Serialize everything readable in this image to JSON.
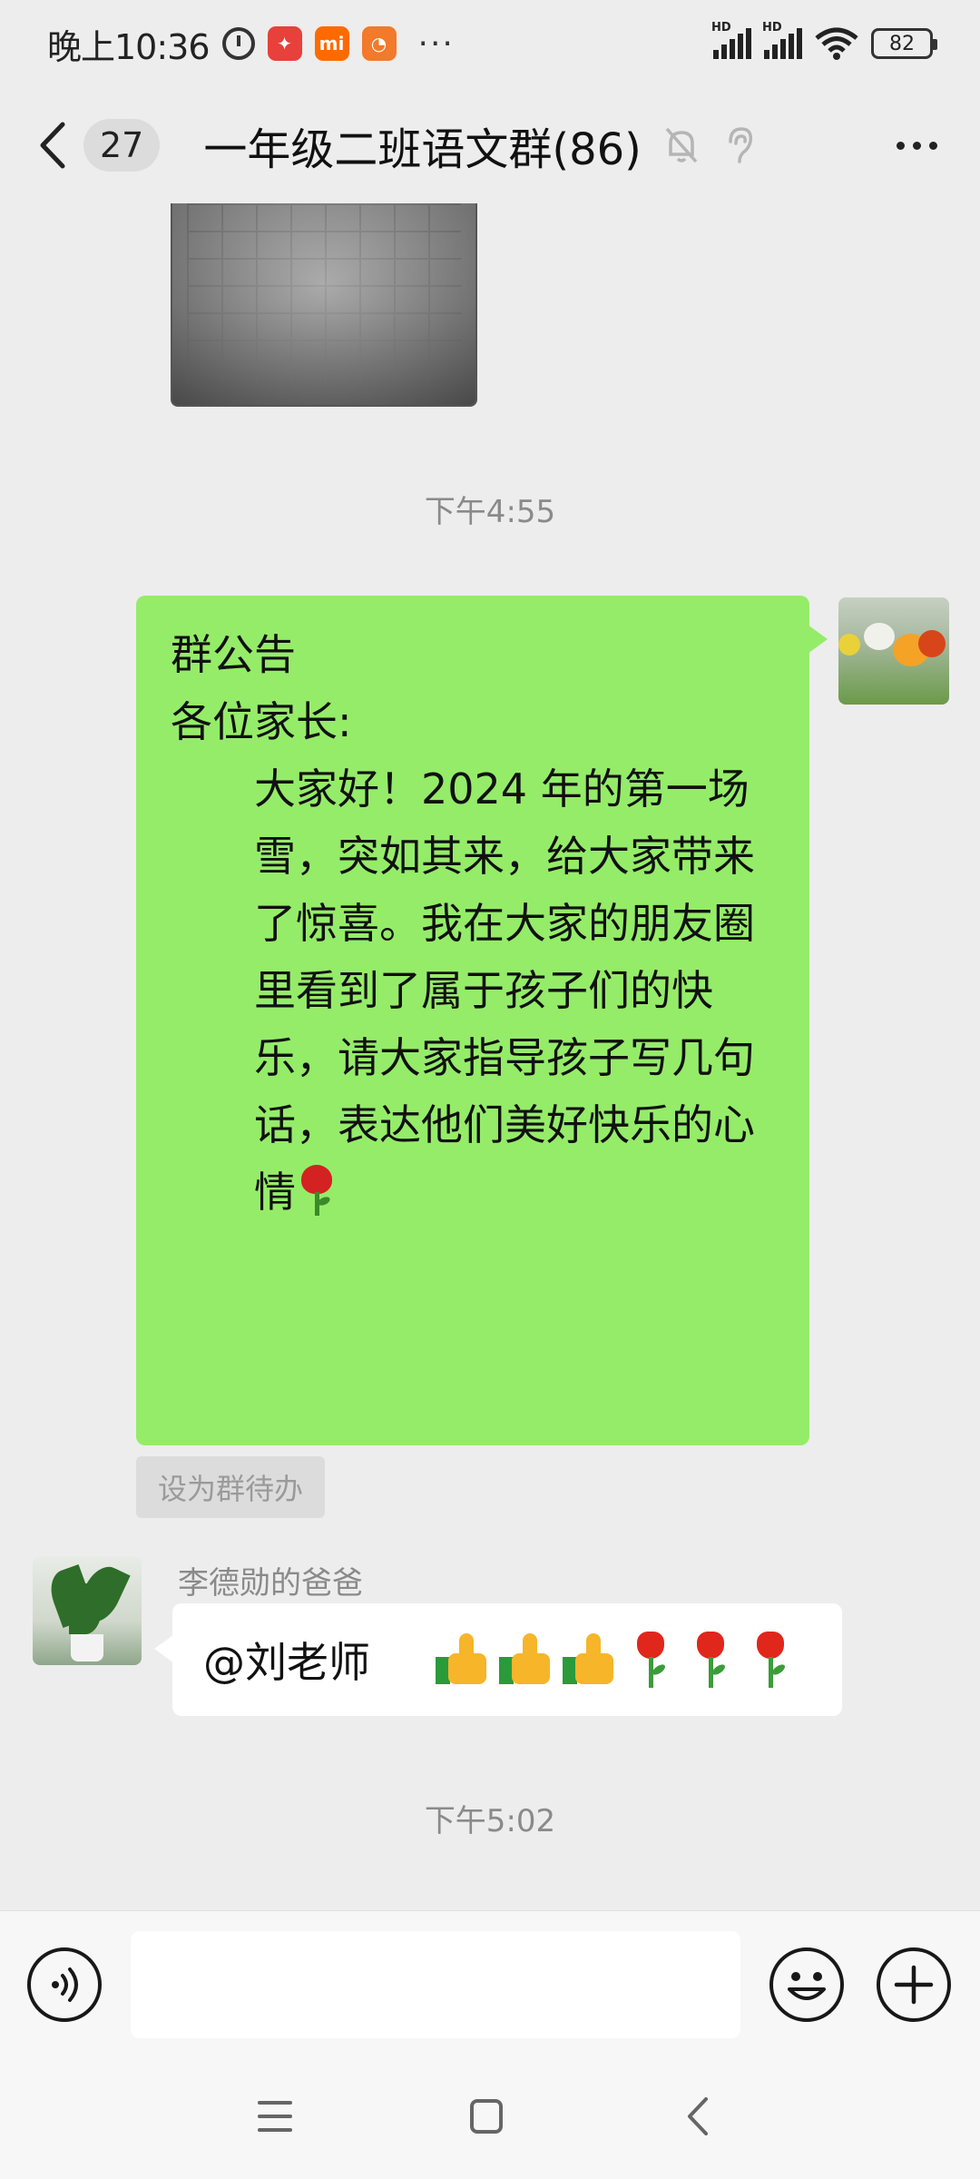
{
  "status_bar": {
    "time": "晚上10:36",
    "battery": "82",
    "signal_label_1": "HD",
    "signal_label_2": "HD",
    "app_icons": [
      "alarm-icon",
      "app-red-icon",
      "mi-icon",
      "app-orange-icon"
    ],
    "mi_label": "mi",
    "more": "···"
  },
  "header": {
    "unread_count": "27",
    "title": "一年级二班语文群(86)",
    "icons": [
      "mute-bell-icon",
      "ear-icon"
    ]
  },
  "chat": {
    "timestamp_1": "下午4:55",
    "self_message": {
      "line1": "群公告",
      "line2": "各位家长:",
      "body": "大家好！2024 年的第一场雪，突如其来，给大家带来了惊喜。我在大家的朋友圈里看到了属于孩子们的快乐，请大家指导孩子写几句话，表达他们美好快乐的心情",
      "emoji": "rose-icon"
    },
    "todo_label": "设为群待办",
    "other_message": {
      "sender": "李德勋的爸爸",
      "text": "@刘老师",
      "emojis": [
        "thumbs-up-icon",
        "thumbs-up-icon",
        "thumbs-up-icon",
        "tulip-icon",
        "tulip-icon",
        "tulip-icon"
      ]
    },
    "timestamp_2": "下午5:02"
  },
  "input_bar": {
    "value": "",
    "placeholder": ""
  },
  "colors": {
    "background": "#ededed",
    "self_bubble": "#95ec69",
    "other_bubble": "#ffffff",
    "timestamp": "#8a8a8a"
  }
}
